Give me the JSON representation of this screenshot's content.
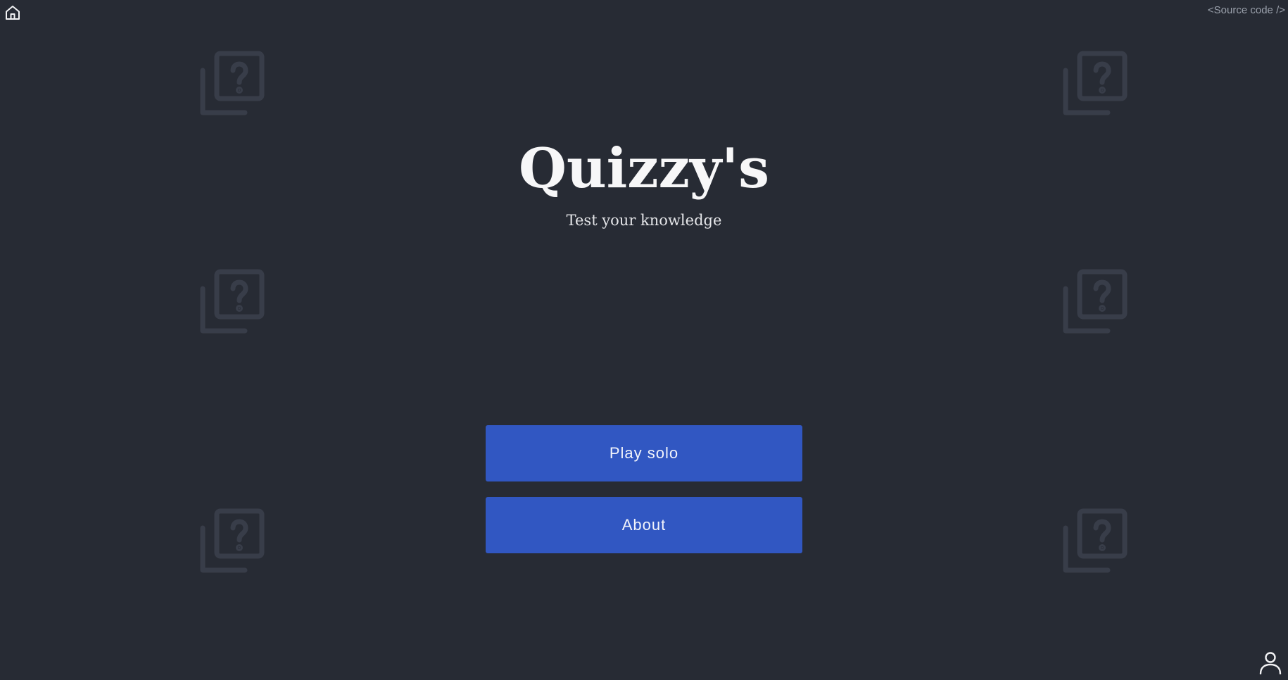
{
  "header": {
    "home_icon": "home-icon",
    "source_link_label": "<Source code />"
  },
  "hero": {
    "title": "Quizzy's",
    "subtitle": "Test your knowledge"
  },
  "menu": {
    "play_solo_label": "Play solo",
    "about_label": "About"
  },
  "footer": {
    "user_icon": "user-icon"
  },
  "background": {
    "icon": "quiz-question-icon"
  },
  "colors": {
    "background": "#272b34",
    "button": "#3157c2",
    "watermark": "#383d49",
    "text": "#f4f4f6"
  }
}
